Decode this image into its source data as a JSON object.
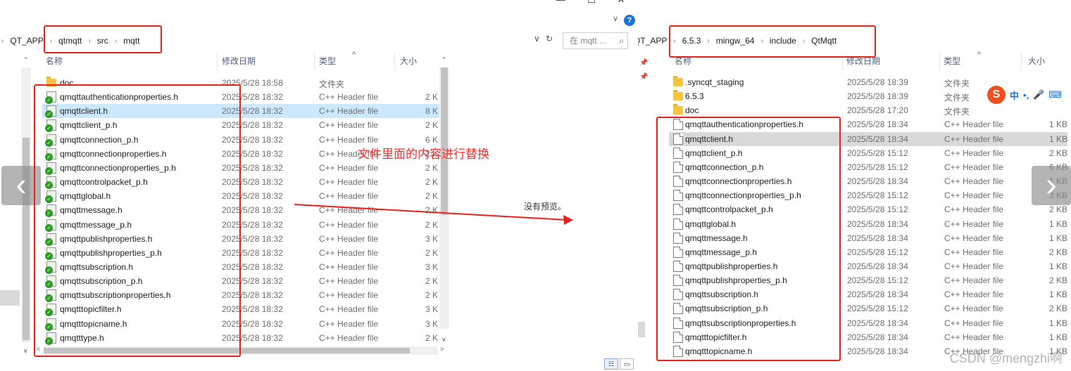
{
  "left": {
    "window_controls": {
      "minimize": "—",
      "maximize": "☐",
      "close": "✕",
      "help": "?"
    },
    "breadcrumbs": [
      "QT_APP",
      "qtmqtt",
      "src",
      "mqtt"
    ],
    "search_placeholder": "在 mqtt ...",
    "columns": {
      "name": "名称",
      "date": "修改日期",
      "type": "类型",
      "size": "大小"
    },
    "rows": [
      {
        "icon": "folder",
        "name": "doc",
        "date": "2025/5/28 18:58",
        "type": "文件夹",
        "size": ""
      },
      {
        "icon": "hfile",
        "name": "qmqttauthenticationproperties.h",
        "date": "2025/5/28 18:32",
        "type": "C++ Header file",
        "size": "2 K"
      },
      {
        "icon": "hfile",
        "name": "qmqttclient.h",
        "date": "2025/5/28 18:32",
        "type": "C++ Header file",
        "size": "8 K",
        "selected": true
      },
      {
        "icon": "hfile",
        "name": "qmqttclient_p.h",
        "date": "2025/5/28 18:32",
        "type": "C++ Header file",
        "size": "2 K"
      },
      {
        "icon": "hfile",
        "name": "qmqttconnection_p.h",
        "date": "2025/5/28 18:32",
        "type": "C++ Header file",
        "size": "6 K"
      },
      {
        "icon": "hfile",
        "name": "qmqttconnectionproperties.h",
        "date": "2025/5/28 18:32",
        "type": "C++ Header file",
        "size": "2 K"
      },
      {
        "icon": "hfile",
        "name": "qmqttconnectionproperties_p.h",
        "date": "2025/5/28 18:32",
        "type": "C++ Header file",
        "size": "2 K"
      },
      {
        "icon": "hfile",
        "name": "qmqttcontrolpacket_p.h",
        "date": "2025/5/28 18:32",
        "type": "C++ Header file",
        "size": "2 K"
      },
      {
        "icon": "hfile",
        "name": "qmqttglobal.h",
        "date": "2025/5/28 18:32",
        "type": "C++ Header file",
        "size": "2 K"
      },
      {
        "icon": "hfile",
        "name": "qmqttmessage.h",
        "date": "2025/5/28 18:32",
        "type": "C++ Header file",
        "size": "2 K"
      },
      {
        "icon": "hfile",
        "name": "qmqttmessage_p.h",
        "date": "2025/5/28 18:32",
        "type": "C++ Header file",
        "size": "2 K"
      },
      {
        "icon": "hfile",
        "name": "qmqttpublishproperties.h",
        "date": "2025/5/28 18:32",
        "type": "C++ Header file",
        "size": "3 K"
      },
      {
        "icon": "hfile",
        "name": "qmqttpublishproperties_p.h",
        "date": "2025/5/28 18:32",
        "type": "C++ Header file",
        "size": "2 K"
      },
      {
        "icon": "hfile",
        "name": "qmqttsubscription.h",
        "date": "2025/5/28 18:32",
        "type": "C++ Header file",
        "size": "3 K"
      },
      {
        "icon": "hfile",
        "name": "qmqttsubscription_p.h",
        "date": "2025/5/28 18:32",
        "type": "C++ Header file",
        "size": "2 K"
      },
      {
        "icon": "hfile",
        "name": "qmqttsubscriptionproperties.h",
        "date": "2025/5/28 18:32",
        "type": "C++ Header file",
        "size": "2 K"
      },
      {
        "icon": "hfile",
        "name": "qmqtttopicfilter.h",
        "date": "2025/5/28 18:32",
        "type": "C++ Header file",
        "size": "3 K"
      },
      {
        "icon": "hfile",
        "name": "qmqtttopicname.h",
        "date": "2025/5/28 18:32",
        "type": "C++ Header file",
        "size": "3 K"
      },
      {
        "icon": "hfile",
        "name": "qmqtttype.h",
        "date": "2025/5/28 18:32",
        "type": "C++ Header file",
        "size": "2 K"
      }
    ],
    "preview_text": "没有预览。",
    "annotation": "文件里面的内容进行替换"
  },
  "right": {
    "breadcrumbs": [
      "QT_APP",
      "6.5.3",
      "mingw_64",
      "include",
      "QtMqtt"
    ],
    "columns": {
      "name": "名称",
      "date": "修改日期",
      "type": "类型",
      "size": "大小"
    },
    "rows": [
      {
        "icon": "folder",
        "name": ".syncqt_staging",
        "date": "2025/5/28 18:39",
        "type": "文件夹",
        "size": ""
      },
      {
        "icon": "folder",
        "name": "6.5.3",
        "date": "2025/5/28 18:39",
        "type": "文件夹",
        "size": ""
      },
      {
        "icon": "folder",
        "name": "doc",
        "date": "2025/5/28 17:20",
        "type": "文件夹",
        "size": ""
      },
      {
        "icon": "file",
        "name": "qmqttauthenticationproperties.h",
        "date": "2025/5/28 18:34",
        "type": "C++ Header file",
        "size": "1 KB"
      },
      {
        "icon": "file",
        "name": "qmqttclient.h",
        "date": "2025/5/28 18:34",
        "type": "C++ Header file",
        "size": "1 KB",
        "hover": true
      },
      {
        "icon": "file",
        "name": "qmqttclient_p.h",
        "date": "2025/5/28 15:12",
        "type": "C++ Header file",
        "size": "2 KB"
      },
      {
        "icon": "file",
        "name": "qmqttconnection_p.h",
        "date": "2025/5/28 15:12",
        "type": "C++ Header file",
        "size": "6 KB"
      },
      {
        "icon": "file",
        "name": "qmqttconnectionproperties.h",
        "date": "2025/5/28 18:34",
        "type": "C++ Header file",
        "size": "1 KB"
      },
      {
        "icon": "file",
        "name": "qmqttconnectionproperties_p.h",
        "date": "2025/5/28 15:12",
        "type": "C++ Header file",
        "size": "3 KB"
      },
      {
        "icon": "file",
        "name": "qmqttcontrolpacket_p.h",
        "date": "2025/5/28 15:12",
        "type": "C++ Header file",
        "size": "2 KB"
      },
      {
        "icon": "file",
        "name": "qmqttglobal.h",
        "date": "2025/5/28 18:34",
        "type": "C++ Header file",
        "size": "1 KB"
      },
      {
        "icon": "file",
        "name": "qmqttmessage.h",
        "date": "2025/5/28 18:34",
        "type": "C++ Header file",
        "size": "1 KB"
      },
      {
        "icon": "file",
        "name": "qmqttmessage_p.h",
        "date": "2025/5/28 15:12",
        "type": "C++ Header file",
        "size": "2 KB"
      },
      {
        "icon": "file",
        "name": "qmqttpublishproperties.h",
        "date": "2025/5/28 18:34",
        "type": "C++ Header file",
        "size": "1 KB"
      },
      {
        "icon": "file",
        "name": "qmqttpublishproperties_p.h",
        "date": "2025/5/28 15:12",
        "type": "C++ Header file",
        "size": "2 KB"
      },
      {
        "icon": "file",
        "name": "qmqttsubscription.h",
        "date": "2025/5/28 18:34",
        "type": "C++ Header file",
        "size": "1 KB"
      },
      {
        "icon": "file",
        "name": "qmqttsubscription_p.h",
        "date": "2025/5/28 15:12",
        "type": "C++ Header file",
        "size": "2 KB"
      },
      {
        "icon": "file",
        "name": "qmqttsubscriptionproperties.h",
        "date": "2025/5/28 18:34",
        "type": "C++ Header file",
        "size": "1 KB"
      },
      {
        "icon": "file",
        "name": "qmqtttopicfilter.h",
        "date": "2025/5/28 18:34",
        "type": "C++ Header file",
        "size": "1 KB"
      },
      {
        "icon": "file",
        "name": "qmqtttopicname.h",
        "date": "2025/5/28 18:34",
        "type": "C++ Header file",
        "size": "1 KB"
      }
    ],
    "ime_toolbar": {
      "logo": "S",
      "lang": "中",
      "punct": "•,",
      "mic": "🎤",
      "keyboard": "⌨"
    }
  },
  "watermark": "CSDN @mengzhi啊",
  "colors": {
    "annotation": "#e8221b",
    "selected_row": "#cce8ff",
    "hover_row": "#d9d9d9",
    "header_text": "#4d6082"
  }
}
